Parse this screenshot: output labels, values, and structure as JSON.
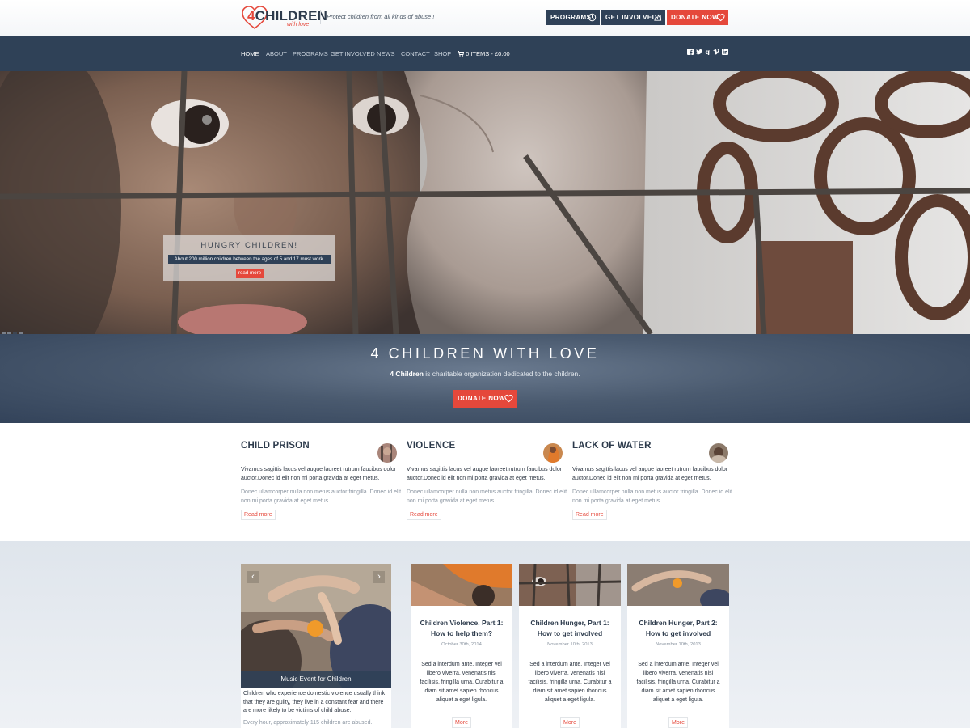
{
  "brand": {
    "logo_number": "4",
    "logo_word": "CHILDREN",
    "logo_sub": "with love",
    "tagline": "Protect children from all kinds of abuse !"
  },
  "header_buttons": {
    "programs": "PROGRAMS",
    "get_involved": "GET INVOLVED",
    "donate": "DONATE NOW"
  },
  "nav": {
    "items": [
      "HOME",
      "ABOUT",
      "PROGRAMS",
      "GET INVOLVED",
      "NEWS",
      "CONTACT",
      "SHOP"
    ],
    "cart": "0 ITEMS - £0.00",
    "active_index": 0,
    "social_icons": [
      "facebook-icon",
      "twitter-icon",
      "google-plus-icon",
      "vimeo-icon",
      "linkedin-icon"
    ]
  },
  "hero": {
    "caption_title": "HUNGRY CHILDREN!",
    "caption_subtitle": "About 200 million children between the ages of 5 and 17 must work.",
    "caption_button": "read more",
    "active_slide": 3,
    "slide_count": 4
  },
  "mission": {
    "title": "4 CHILDREN WITH LOVE",
    "text_bold": "4 Children",
    "text_rest": " is charitable organization dedicated to the children.",
    "button": "DONATE NOW"
  },
  "features": [
    {
      "title": "CHILD PRISON",
      "bold_text": "Vivamus sagittis lacus vel augue laoreet rutrum faucibus dolor auctor.Donec id elit non mi porta gravida at eget metus.",
      "light_text": "Donec ullamcorper nulla non metus auctor fringilla. Donec id elit non mi porta gravida at eget metus.",
      "more": "Read more"
    },
    {
      "title": "VIOLENCE",
      "bold_text": "Vivamus sagittis lacus vel augue laoreet rutrum faucibus dolor auctor.Donec id elit non mi porta gravida at eget metus.",
      "light_text": "Donec ullamcorper nulla non metus auctor fringilla. Donec id elit non mi porta gravida at eget metus.",
      "more": "Read more"
    },
    {
      "title": "LACK OF WATER",
      "bold_text": "Vivamus sagittis lacus vel augue laoreet rutrum faucibus dolor auctor.Donec id elit non mi porta gravida at eget metus.",
      "light_text": "Donec ullamcorper nulla non metus auctor fringilla. Donec id elit non mi porta gravida at eget metus.",
      "more": "Read more"
    }
  ],
  "event": {
    "label": "Music Event for Children",
    "text": "Children who experience domestic violence usually think that they are guilty, they live in a constant fear and there are more likely to be victims of child abuse.",
    "text2": "Every hour, approximately 115 children are abused."
  },
  "posts": [
    {
      "title": "Children Violence, Part 1: How to help them?",
      "date": "October 30th, 2014",
      "text": "Sed a interdum ante. Integer vel libero viverra, venenatis nisi facilisis, fringilla urna. Curabitur a diam sit amet sapien rhoncus aliquet a eget ligula.",
      "more": "More"
    },
    {
      "title": "Children Hunger, Part 1: How to get involved",
      "date": "November 10th, 2013",
      "text": "Sed a interdum ante. Integer vel libero viverra, venenatis nisi facilisis, fringilla urna. Curabitur a diam sit amet sapien rhoncus aliquet a eget ligula.",
      "more": "More"
    },
    {
      "title": "Children Hunger, Part 2: How to get involved",
      "date": "November 10th, 2013",
      "text": "Sed a interdum ante. Integer vel libero viverra, venenatis nisi facilisis, fringilla urna. Curabitur a diam sit amet sapien rhoncus aliquet a eget ligula.",
      "more": "More"
    }
  ],
  "colors": {
    "accent": "#e5483b",
    "navy": "#2f4157",
    "text": "#2d3b4c"
  }
}
